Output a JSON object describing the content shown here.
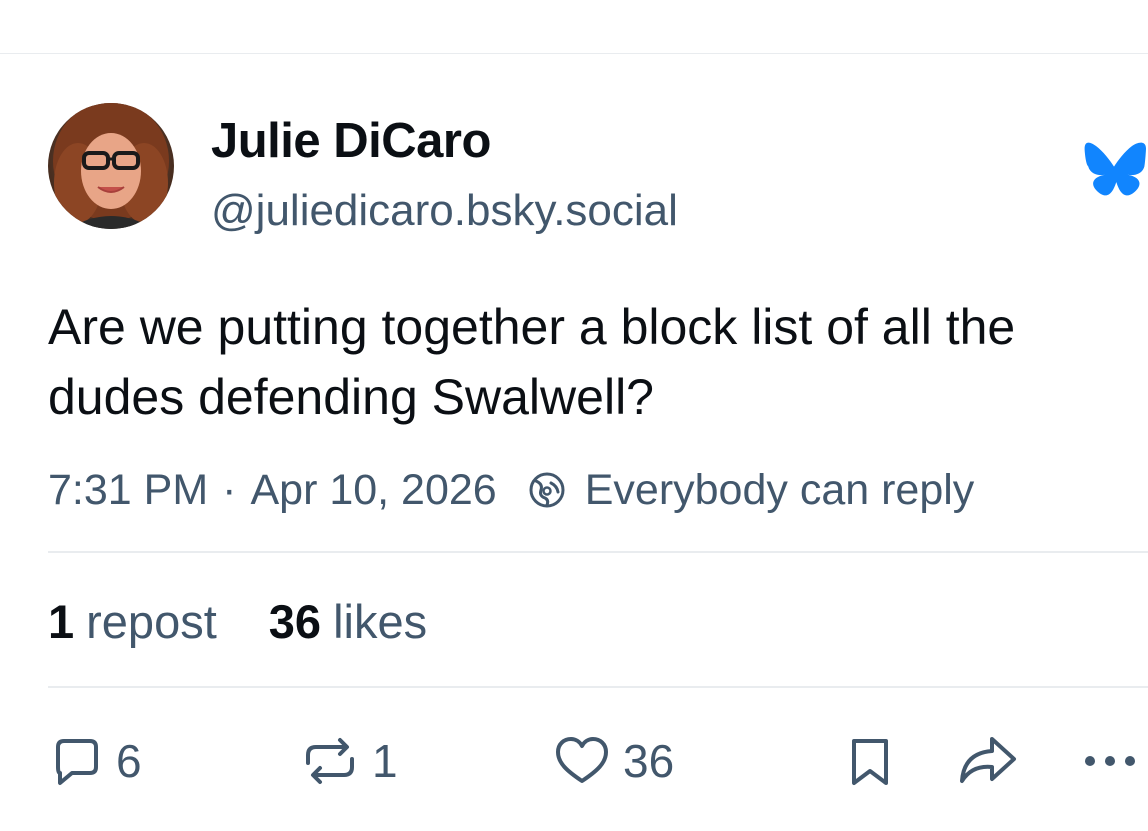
{
  "post": {
    "author": {
      "display_name": "Julie DiCaro",
      "handle": "@juliedicaro.bsky.social"
    },
    "text": "Are we putting together a block list of all the dudes defending Swalwell?",
    "time": "7:31 PM",
    "separator": "·",
    "date": "Apr 10, 2026",
    "reply_setting": "Everybody can reply"
  },
  "stats": {
    "reposts_count": "1",
    "reposts_label": "repost",
    "likes_count": "36",
    "likes_label": "likes"
  },
  "actions": {
    "reply_count": "6",
    "repost_count": "1",
    "like_count": "36"
  },
  "icons": {
    "brand": "butterfly-icon",
    "reply_setting": "globe-icon",
    "reply": "comment-icon",
    "repost": "repost-icon",
    "like": "heart-icon",
    "bookmark": "bookmark-icon",
    "share": "share-icon",
    "more": "more-icon"
  },
  "colors": {
    "brand_blue": "#1185fe",
    "text": "#0b0f14",
    "muted": "#42576c",
    "divider": "#e9ecef"
  }
}
